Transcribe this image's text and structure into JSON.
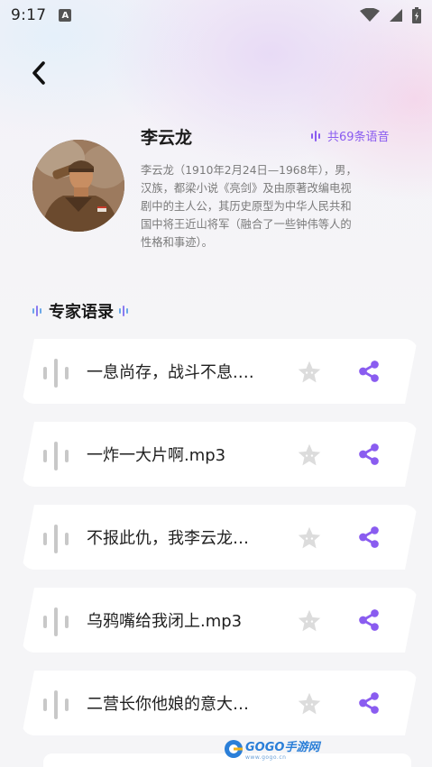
{
  "status_bar": {
    "time": "9:17",
    "notification_icon": "A"
  },
  "header": {
    "back_icon": "chevron-left-icon"
  },
  "profile": {
    "name": "李云龙",
    "voice_count": "共69条语音",
    "description": "李云龙（1910年2月24日—1968年），男，汉族，都梁小说《亮剑》及由原著改编电视剧中的主人公，其历史原型为中华人民共和国中将王近山将军（融合了一些钟伟等人的性格和事迹）。"
  },
  "section": {
    "title": "专家语录"
  },
  "audio_list": [
    {
      "title": "一息尚存，战斗不息.…"
    },
    {
      "title": "一炸一大片啊.mp3"
    },
    {
      "title": "不报此仇，我李云龙…"
    },
    {
      "title": "乌鸦嘴给我闭上.mp3"
    },
    {
      "title": "二营长你他娘的意大…"
    }
  ],
  "watermark": {
    "text": "GOGO手游网",
    "sub": "www.gogo.cn"
  },
  "colors": {
    "accent": "#8a5cf0",
    "wave": "#c8c8c8",
    "star": "#dcdcdc",
    "card": "#ffffff"
  }
}
